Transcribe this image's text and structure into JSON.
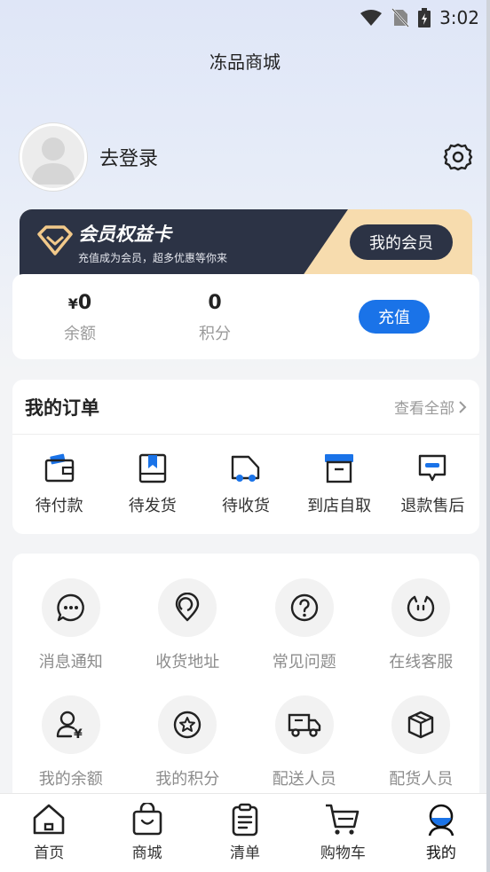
{
  "status_bar": {
    "time": "3:02"
  },
  "header": {
    "title": "冻品商城"
  },
  "profile": {
    "login_text": "去登录"
  },
  "vip_card": {
    "title": "会员权益卡",
    "subtitle": "充值成为会员，超多优惠等你来",
    "button_label": "我的会员"
  },
  "balance": {
    "yen_symbol": "¥",
    "balance_value": "0",
    "balance_label": "余额",
    "points_value": "0",
    "points_label": "积分",
    "recharge_label": "充值"
  },
  "orders": {
    "title": "我的订单",
    "view_all": "查看全部",
    "items": [
      {
        "label": "待付款",
        "icon": "wallet-icon"
      },
      {
        "label": "待发货",
        "icon": "box-bookmark-icon"
      },
      {
        "label": "待收货",
        "icon": "truck-icon"
      },
      {
        "label": "到店自取",
        "icon": "archive-box-icon"
      },
      {
        "label": "退款售后",
        "icon": "chat-refund-icon"
      }
    ]
  },
  "services": {
    "items": [
      {
        "label": "消息通知",
        "icon": "message-icon"
      },
      {
        "label": "收货地址",
        "icon": "location-pin-icon"
      },
      {
        "label": "常见问题",
        "icon": "question-icon"
      },
      {
        "label": "在线客服",
        "icon": "customer-service-icon"
      },
      {
        "label": "我的余额",
        "icon": "user-yen-icon"
      },
      {
        "label": "我的积分",
        "icon": "star-badge-icon"
      },
      {
        "label": "配送人员",
        "icon": "delivery-truck-icon"
      },
      {
        "label": "配货人员",
        "icon": "package-icon"
      }
    ]
  },
  "tabbar": {
    "items": [
      {
        "label": "首页",
        "icon": "home-icon"
      },
      {
        "label": "商城",
        "icon": "shopping-bag-icon"
      },
      {
        "label": "清单",
        "icon": "clipboard-list-icon"
      },
      {
        "label": "购物车",
        "icon": "cart-icon"
      },
      {
        "label": "我的",
        "icon": "profile-icon"
      }
    ],
    "active_index": 4
  },
  "colors": {
    "accent_blue": "#1a73e8",
    "vip_dark": "#2c3345",
    "vip_gold": "#f7dcae"
  }
}
